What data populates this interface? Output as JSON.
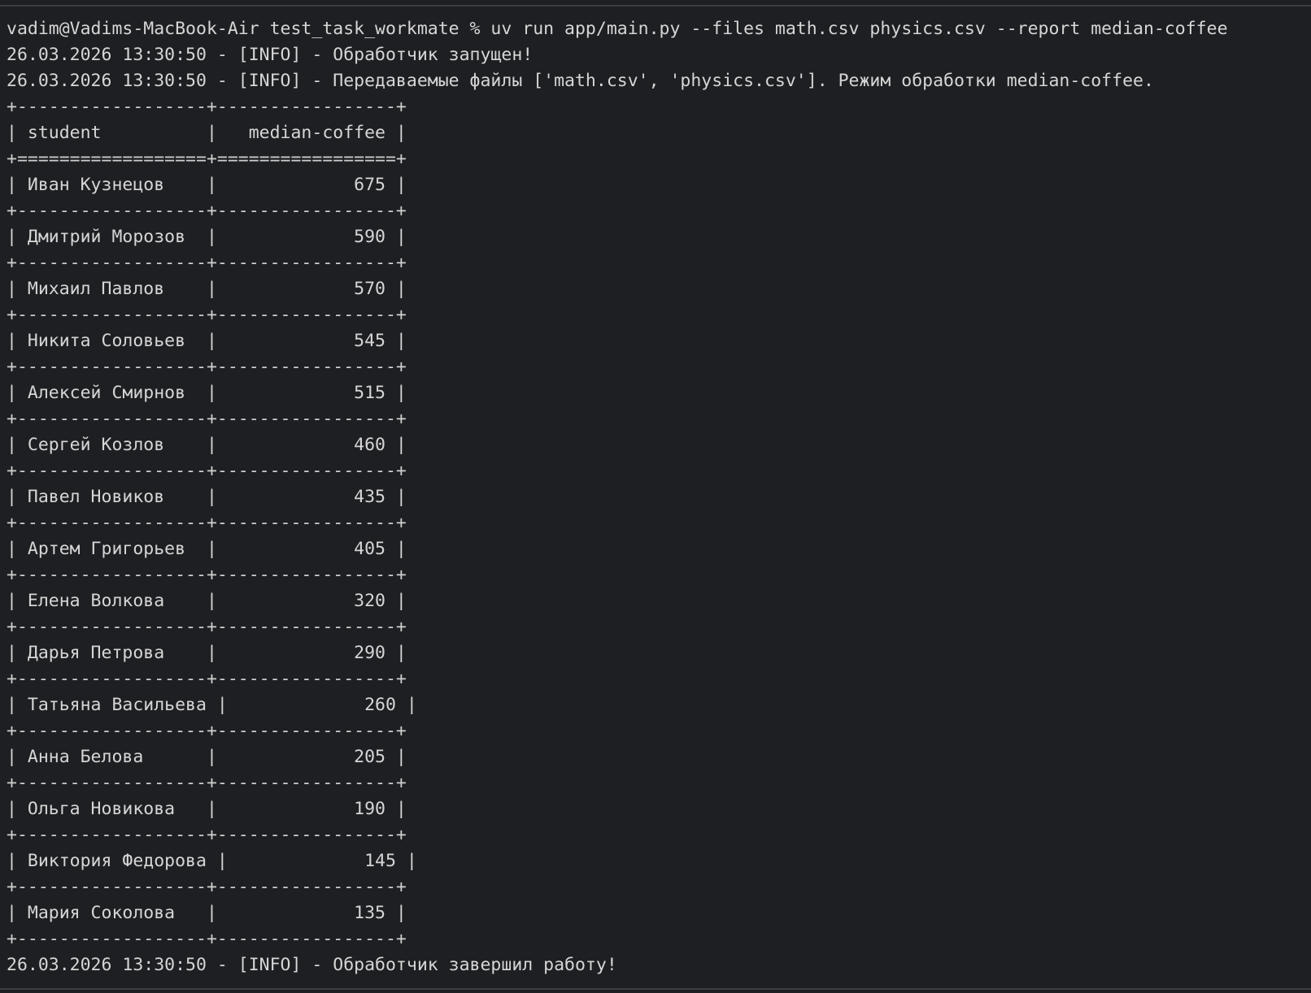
{
  "prompt": {
    "user_host": "vadim@Vadims-MacBook-Air",
    "cwd": "test_task_workmate",
    "symbol": "%",
    "command": "uv run app/main.py --files math.csv physics.csv --report median-coffee"
  },
  "log_start": [
    "26.03.2026 13:30:50 - [INFO] - Обработчик запущен!",
    "26.03.2026 13:30:50 - [INFO] - Передаваемые файлы ['math.csv', 'physics.csv']. Режим обработки median-coffee."
  ],
  "table": {
    "columns": [
      "student",
      "median-coffee"
    ],
    "rows": [
      {
        "student": "Иван Кузнецов",
        "value": "675"
      },
      {
        "student": "Дмитрий Морозов",
        "value": "590"
      },
      {
        "student": "Михаил Павлов",
        "value": "570"
      },
      {
        "student": "Никита Соловьев",
        "value": "545"
      },
      {
        "student": "Алексей Смирнов",
        "value": "515"
      },
      {
        "student": "Сергей Козлов",
        "value": "460"
      },
      {
        "student": "Павел Новиков",
        "value": "435"
      },
      {
        "student": "Артем Григорьев",
        "value": "405"
      },
      {
        "student": "Елена Волкова",
        "value": "320"
      },
      {
        "student": "Дарья Петрова",
        "value": "290"
      },
      {
        "student": "Татьяна Васильева",
        "value": "260"
      },
      {
        "student": "Анна Белова",
        "value": "205"
      },
      {
        "student": "Ольга Новикова",
        "value": "190"
      },
      {
        "student": "Виктория Федорова",
        "value": "145"
      },
      {
        "student": "Мария Соколова",
        "value": "135"
      }
    ]
  },
  "log_end": "26.03.2026 13:30:50 - [INFO] - Обработчик завершил работу!"
}
